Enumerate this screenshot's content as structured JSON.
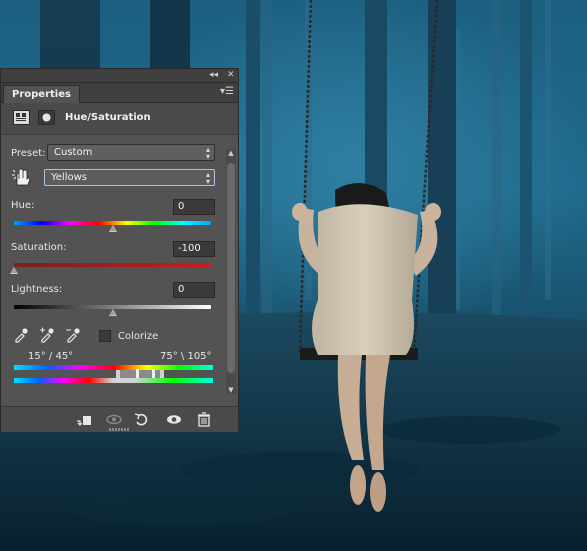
{
  "panel": {
    "tab_label": "Properties",
    "title": "Hue/Saturation",
    "icons": {
      "collapse": "double-chevron-left-icon",
      "close": "close-icon",
      "menu": "panel-menu-icon",
      "adjustment_layer": "adjustment-layer-icon",
      "mask": "layer-mask-icon",
      "target_adjustment": "hand-target-icon"
    },
    "preset": {
      "label": "Preset:",
      "value": "Custom"
    },
    "channel": {
      "value": "Yellows"
    },
    "hue": {
      "label": "Hue:",
      "value": "0",
      "level": 0
    },
    "saturation": {
      "label": "Saturation:",
      "value": "-100",
      "level": -100
    },
    "lightness": {
      "label": "Lightness:",
      "value": "0",
      "level": 0
    },
    "colorize": {
      "label": "Colorize",
      "checked": false
    },
    "range": {
      "left": "15° / 45°",
      "right": "75° \\ 105°"
    },
    "footer_icons": [
      "clip-to-layer-icon",
      "view-previous-state-icon",
      "reset-icon",
      "visibility-eye-icon",
      "trash-icon"
    ]
  },
  "colors": {
    "panel_bg": "#535353",
    "panel_header": "#3f3f3f",
    "hue_track": "spectrum",
    "saturation_track": "#b31c1c",
    "lightness_track": "#ffffff",
    "background_tint": "#1f6a8c"
  }
}
